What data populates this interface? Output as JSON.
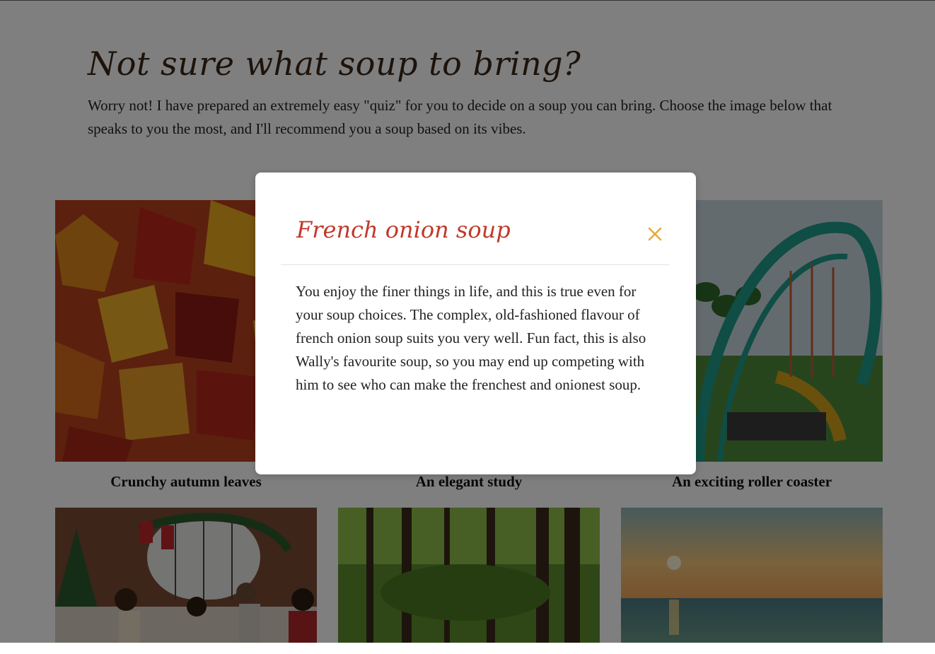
{
  "page": {
    "title": "Not sure what soup to bring?",
    "intro": "Worry not! I have prepared an extremely easy \"quiz\" for you to decide on a soup you can bring. Choose the image below that speaks to you the most, and I'll recommend you a soup based on its vibes."
  },
  "cards": [
    {
      "caption": "Crunchy autumn leaves",
      "image": "autumn-leaves"
    },
    {
      "caption": "An elegant study",
      "image": "elegant-study"
    },
    {
      "caption": "An exciting roller coaster",
      "image": "roller-coaster"
    },
    {
      "caption": "",
      "image": "christmas-dinner"
    },
    {
      "caption": "",
      "image": "forest-path"
    },
    {
      "caption": "",
      "image": "sunset-beach"
    }
  ],
  "modal": {
    "title": "French onion soup",
    "body": "You enjoy the finer things in life, and this is true even for your soup choices. The complex, old-fashioned flavour of french onion soup suits you very well. Fun fact, this is also Wally's favourite soup, so you may end up competing with him to see who can make the frenchest and onionest soup.",
    "close_icon": "close-icon"
  },
  "colors": {
    "title": "#3a2616",
    "modal_title": "#c0392b",
    "close": "#e8a83a",
    "overlay": "rgba(0,0,0,0.5)"
  }
}
